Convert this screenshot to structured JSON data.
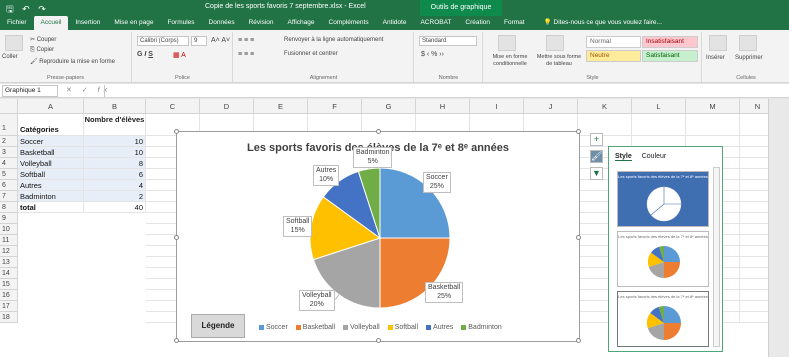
{
  "window": {
    "doc_title": "Copie de les sports favoris 7 septembre.xlsx - Excel",
    "contextual_tab": "Outils de graphique"
  },
  "tabs": [
    "Fichier",
    "Accueil",
    "Insertion",
    "Mise en page",
    "Formules",
    "Données",
    "Révision",
    "Affichage",
    "Compléments",
    "Antidote",
    "ACROBAT",
    "Création",
    "Format"
  ],
  "active_tab": "Accueil",
  "tell_me": "Dites-nous ce que vous voulez faire...",
  "ribbon": {
    "clipboard": {
      "paste": "Coller",
      "cut": "Couper",
      "copy": "Copier",
      "format_painter": "Reproduire la mise en forme",
      "label": "Presse-papiers"
    },
    "font": {
      "name": "Calibri (Corps)",
      "size": "9",
      "label": "Police"
    },
    "alignment": {
      "wrap": "Renvoyer à la ligne automatiquement",
      "merge": "Fusionner et centrer",
      "label": "Alignement"
    },
    "number": {
      "format": "Standard",
      "label": "Nombre"
    },
    "styles": {
      "conditional": "Mise en forme conditionnelle",
      "table": "Mettre sous forme de tableau",
      "normal": "Normal",
      "insufficient": "Insatisfaisant",
      "neutral": "Neutre",
      "satisfying": "Satisfaisant",
      "label": "Style"
    },
    "cells": {
      "insert": "Insérer",
      "delete": "Supprimer",
      "label": "Cellules"
    }
  },
  "formula_bar": {
    "name_box": "Graphique 1"
  },
  "columns": [
    "A",
    "B",
    "C",
    "D",
    "E",
    "F",
    "G",
    "H",
    "I",
    "J",
    "K",
    "L",
    "M",
    "N"
  ],
  "rows": [
    "1",
    "2",
    "3",
    "4",
    "5",
    "6",
    "7",
    "8",
    "9",
    "10",
    "11",
    "12",
    "13",
    "14",
    "15",
    "16",
    "17",
    "18"
  ],
  "table": {
    "header_a": "Catégories",
    "header_b": "Nombre d'élèves",
    "data": [
      {
        "cat": "Soccer",
        "n": "10"
      },
      {
        "cat": "Basketball",
        "n": "10"
      },
      {
        "cat": "Volleyball",
        "n": "8"
      },
      {
        "cat": "Softball",
        "n": "6"
      },
      {
        "cat": "Autres",
        "n": "4"
      },
      {
        "cat": "Badminton",
        "n": "2"
      }
    ],
    "total_label": "total",
    "total_value": "40"
  },
  "chart_data": {
    "type": "pie",
    "title": "Les sports favoris des élèves de la 7ᵉ et 8ᵉ années",
    "categories": [
      "Soccer",
      "Basketball",
      "Volleyball",
      "Softball",
      "Autres",
      "Badminton"
    ],
    "values": [
      10,
      10,
      8,
      6,
      4,
      2
    ],
    "percent_labels": [
      "25%",
      "25%",
      "20%",
      "15%",
      "10%",
      "5%"
    ],
    "colors": [
      "#5b9bd5",
      "#ed7d31",
      "#a5a5a5",
      "#ffc000",
      "#4472c4",
      "#70ad47"
    ],
    "legend_title": "Légende",
    "legend_position": "bottom"
  },
  "style_pane": {
    "tabs": [
      "Style",
      "Couleur"
    ],
    "active": "Style"
  },
  "accent": "#217346"
}
